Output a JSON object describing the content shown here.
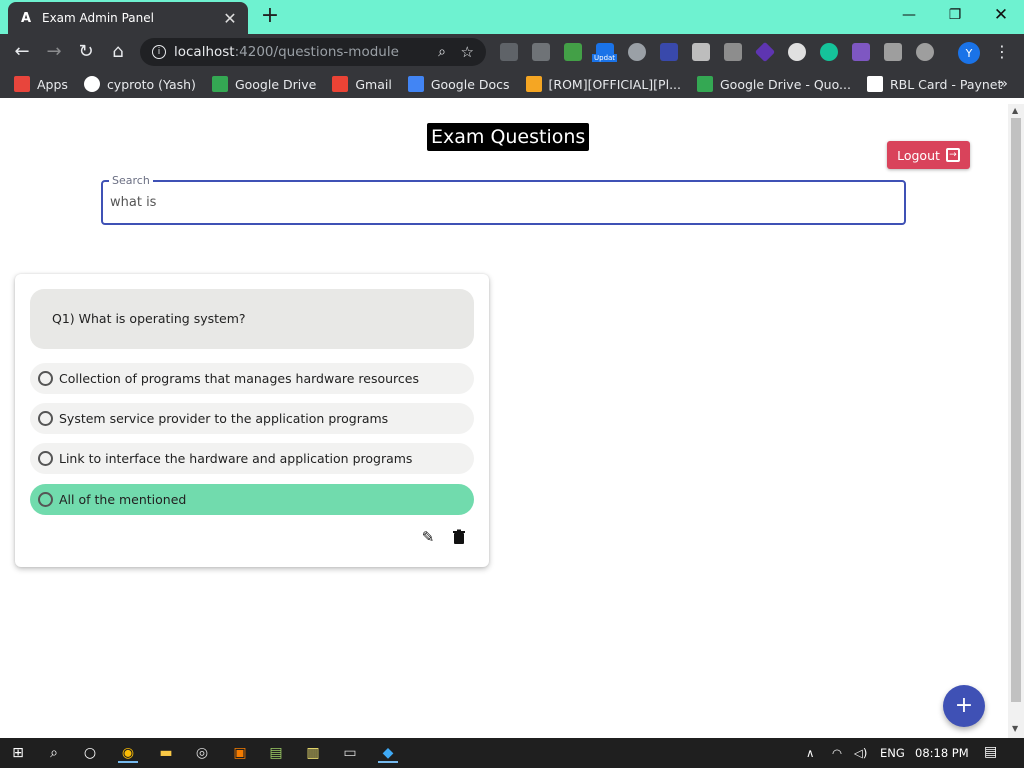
{
  "browser": {
    "tab_title": "Exam Admin Panel",
    "tab_icon": "angular-icon",
    "url_host": "localhost",
    "url_path": ":4200/questions-module",
    "avatar_letter": "Y",
    "extension_badge": "Updat"
  },
  "bookmarks": [
    {
      "label": "Apps",
      "icon": "apps-grid-icon",
      "color": "#e8453c"
    },
    {
      "label": "cyproto (Yash)",
      "icon": "github-icon",
      "color": "#ffffff"
    },
    {
      "label": "Google Drive",
      "icon": "google-drive-icon",
      "color": "#34a853"
    },
    {
      "label": "Gmail",
      "icon": "gmail-icon",
      "color": "#ea4335"
    },
    {
      "label": "Google Docs",
      "icon": "google-docs-icon",
      "color": "#4285f4"
    },
    {
      "label": "[ROM][OFFICIAL][Pl...",
      "icon": "xda-icon",
      "color": "#f5a623"
    },
    {
      "label": "Google Drive - Quo...",
      "icon": "google-drive-icon",
      "color": "#34a853"
    },
    {
      "label": "RBL Card - Paynet",
      "icon": "paynet-icon",
      "color": "#ffffff"
    }
  ],
  "page": {
    "title": "Exam Questions",
    "logout_label": "Logout",
    "search_label": "Search",
    "search_value": "what is"
  },
  "question_card": {
    "question": "Q1) What is operating system?",
    "options": [
      "Collection of programs that manages hardware resources",
      "System service provider to the application programs",
      "Link to interface the hardware and application programs",
      "All of the mentioned"
    ],
    "correct_index": 3,
    "correct_color": "#71dbad"
  },
  "fab_label": "+",
  "taskbar": {
    "language": "ENG",
    "time": "08:18 PM"
  },
  "colors": {
    "primary": "#3f51b5",
    "logout": "#d9435b",
    "tab_strip": "#6ef2d0"
  }
}
